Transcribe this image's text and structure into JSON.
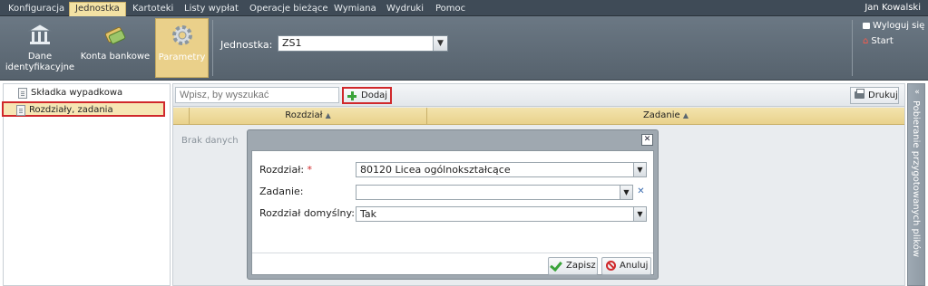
{
  "menubar": {
    "tabs": [
      "Konfiguracja",
      "Jednostka",
      "Kartoteki",
      "Listy wypłat",
      "Operacje bieżące",
      "Wymiana",
      "Wydruki",
      "Pomoc"
    ],
    "active_tab": "Jednostka",
    "user": "Jan Kowalski"
  },
  "ribbon": {
    "buttons": [
      {
        "label": "Dane identyfikacyjne",
        "icon": "bank-building-icon"
      },
      {
        "label": "Konta bankowe",
        "icon": "bank-cards-icon"
      },
      {
        "label": "Parametry",
        "icon": "gear-icon"
      }
    ],
    "unit_label": "Jednostka:",
    "unit_value": "ZS1",
    "logout": "Wyloguj się",
    "start": "Start"
  },
  "sidebar": {
    "items": [
      {
        "label": "Składka wypadkowa"
      },
      {
        "label": "Rozdziały, zadania"
      }
    ]
  },
  "toolbar": {
    "search_placeholder": "Wpisz, by wyszukać",
    "add_label": "Dodaj",
    "print_label": "Drukuj"
  },
  "grid": {
    "columns": [
      "Rozdział",
      "Zadanie"
    ],
    "empty_text": "Brak danych"
  },
  "right_panel": {
    "title": "Pobieranie przygotowanych plików"
  },
  "dialog": {
    "fields": [
      {
        "label": "Rozdział:",
        "value": "80120 Licea ogólnokształcące",
        "required": true
      },
      {
        "label": "Zadanie:",
        "value": "",
        "required": false
      },
      {
        "label": "Rozdział domyślny:",
        "value": "Tak",
        "required": true
      }
    ],
    "required_mark": "*",
    "save_label": "Zapisz",
    "cancel_label": "Anuluj"
  },
  "colors": {
    "accent": "#f3e2a4",
    "highlight_border": "#d0282b",
    "topbar": "#3f4b57",
    "ribbon": "#5e6b76"
  }
}
